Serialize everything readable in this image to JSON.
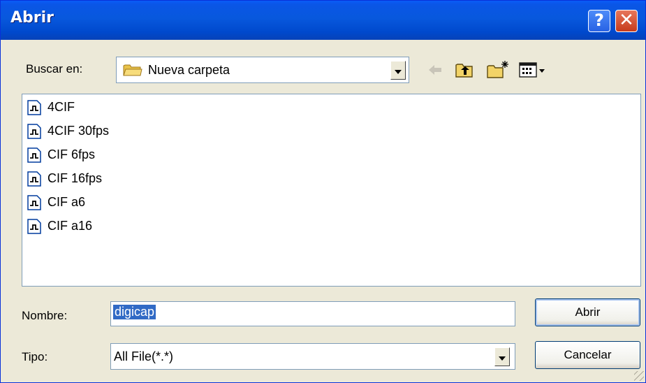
{
  "window": {
    "title": "Abrir",
    "help_icon": "question-mark-icon",
    "close_icon": "x-close-icon"
  },
  "lookin": {
    "label": "Buscar en:",
    "value": "Nueva carpeta",
    "folder_icon": "folder-icon"
  },
  "toolbar": {
    "icons": [
      "back-arrow-icon",
      "up-folder-icon",
      "new-folder-icon",
      "view-menu-icon"
    ]
  },
  "files": [
    {
      "name": "4CIF",
      "icon": "config-file-icon"
    },
    {
      "name": "4CIF 30fps",
      "icon": "config-file-icon"
    },
    {
      "name": "CIF 6fps",
      "icon": "config-file-icon"
    },
    {
      "name": "CIF 16fps",
      "icon": "config-file-icon"
    },
    {
      "name": "CIF a6",
      "icon": "config-file-icon"
    },
    {
      "name": "CIF a16",
      "icon": "config-file-icon"
    }
  ],
  "filename": {
    "label": "Nombre:",
    "value": "digicap"
  },
  "filetype": {
    "label": "Tipo:",
    "value": "All File(*.*)"
  },
  "buttons": {
    "open": "Abrir",
    "cancel": "Cancelar"
  },
  "colors": {
    "titlebar": "#0a5cf7",
    "dialog_bg": "#ece9d8",
    "selection": "#316ac5",
    "close_button": "#d2492a",
    "field_border": "#7f9db9"
  }
}
